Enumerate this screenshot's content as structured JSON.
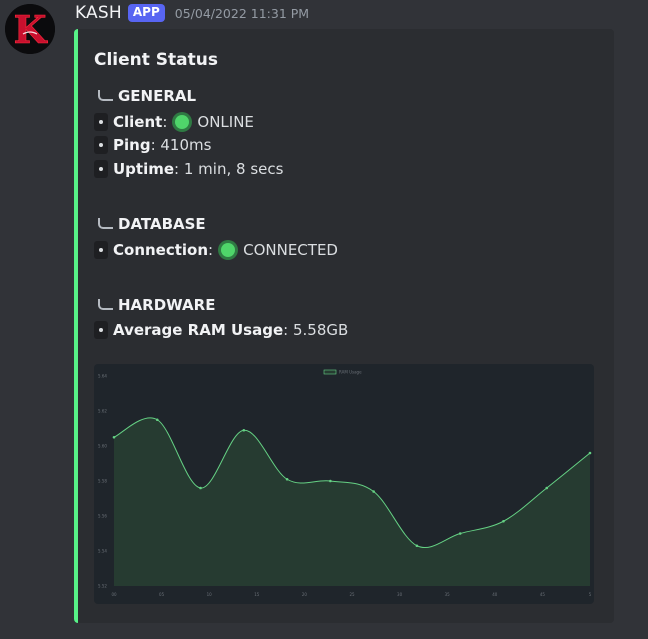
{
  "message": {
    "username": "KASH",
    "badge": "APP",
    "timestamp": "05/04/2022 11:31 PM",
    "avatar_letter": "K"
  },
  "embed": {
    "accent_color": "#57f287",
    "title": "Client Status",
    "general": {
      "heading": "GENERAL",
      "client_key": "Client",
      "client_status": "ONLINE",
      "ping_key": "Ping",
      "ping_value": "410ms",
      "uptime_key": "Uptime",
      "uptime_value": "1 min, 8 secs"
    },
    "database": {
      "heading": "DATABASE",
      "connection_key": "Connection",
      "connection_status": "CONNECTED"
    },
    "hardware": {
      "heading": "HARDWARE",
      "ram_key": "Average RAM Usage",
      "ram_value": "5.58GB"
    },
    "status_icon": "green-circle-icon"
  },
  "chart_data": {
    "type": "area",
    "legend": [
      "RAM Usage"
    ],
    "legend_position": "top",
    "series": [
      {
        "name": "RAM Usage",
        "values": [
          5.605,
          5.615,
          5.576,
          5.609,
          5.581,
          5.58,
          5.574,
          5.543,
          5.55,
          5.557,
          5.576,
          5.596
        ]
      }
    ],
    "x_tick_labels": [
      "00",
      "05",
      "10",
      "15",
      "20",
      "25",
      "30",
      "35",
      "40",
      "45",
      "5"
    ],
    "y_tick_labels": [
      "5.64",
      "5.62",
      "5.60",
      "5.58",
      "5.56",
      "5.54",
      "5.52"
    ],
    "ylim": [
      5.52,
      5.64
    ],
    "line_color": "#65d184",
    "fill_color": "#263b31",
    "background": "#1f252b",
    "grid": false
  }
}
